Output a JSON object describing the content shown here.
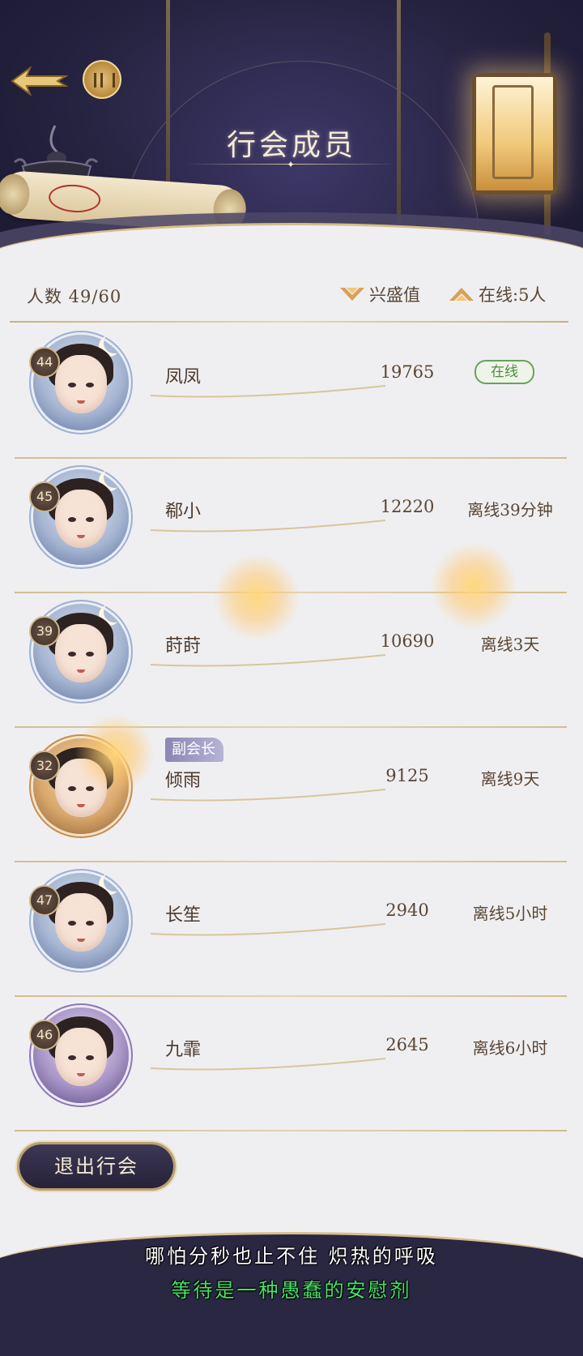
{
  "header": {
    "title": "行会成员"
  },
  "stats": {
    "member_count": "人数 49/60",
    "sort_prosperity": "兴盛值",
    "sort_online": "在线:5人"
  },
  "members": [
    {
      "level": "44",
      "name": "凤凤",
      "score": "19765",
      "status": "在线",
      "online": true
    },
    {
      "level": "45",
      "name": "郗小",
      "score": "12220",
      "status": "离线39分钟"
    },
    {
      "level": "39",
      "name": "莳莳",
      "score": "10690",
      "status": "离线3天"
    },
    {
      "level": "32",
      "name": "倾雨",
      "score": "9125",
      "status": "离线9天",
      "role": "副会长"
    },
    {
      "level": "47",
      "name": "长笙",
      "score": "2940",
      "status": "离线5小时"
    },
    {
      "level": "46",
      "name": "九霏",
      "score": "2645",
      "status": "离线6小时"
    }
  ],
  "exit_button": "退出行会",
  "subtitles": {
    "line1": "哪怕分秒也止不住 炽热的呼吸",
    "line2": "等待是一种愚蠢的安慰剂"
  },
  "colors": {
    "online_green": "#4e8a42",
    "accent_gold": "#c9a35a",
    "header_navy": "#25223f"
  }
}
